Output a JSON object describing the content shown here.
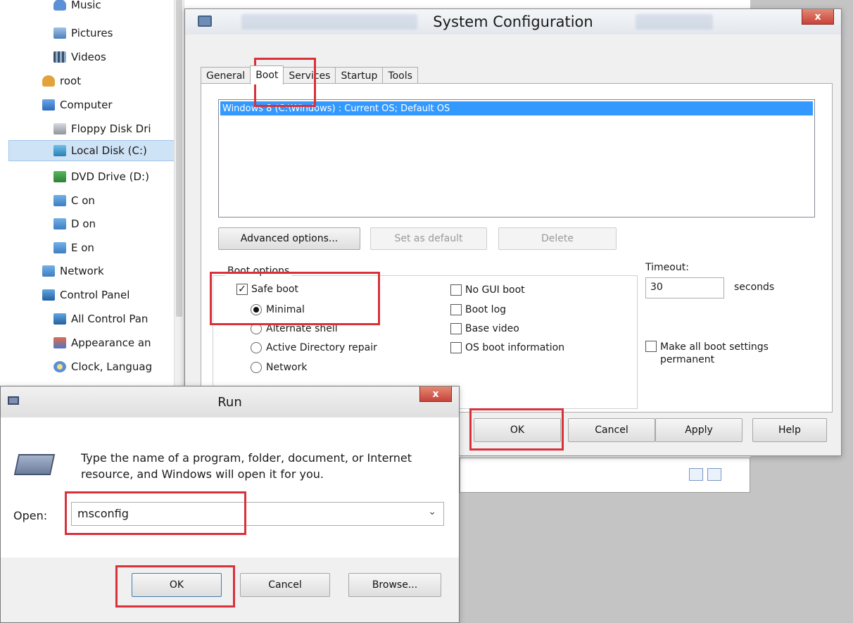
{
  "explorer": {
    "items": [
      {
        "label": "Music",
        "icon": "music-icon"
      },
      {
        "label": "Pictures",
        "icon": "pictures-icon"
      },
      {
        "label": "Videos",
        "icon": "videos-icon"
      },
      {
        "label": "root",
        "icon": "user-folder-icon"
      },
      {
        "label": "Computer",
        "icon": "computer-icon"
      },
      {
        "label": "Floppy Disk Dri",
        "icon": "floppy-drive-icon"
      },
      {
        "label": "Local Disk (C:)",
        "icon": "local-disk-icon"
      },
      {
        "label": "DVD Drive (D:)",
        "icon": "dvd-drive-icon"
      },
      {
        "label": "C on",
        "icon": "network-drive-icon"
      },
      {
        "label": "D on",
        "icon": "network-drive-icon"
      },
      {
        "label": "E on",
        "icon": "network-drive-icon"
      },
      {
        "label": "Network",
        "icon": "network-icon"
      },
      {
        "label": "Control Panel",
        "icon": "control-panel-icon"
      },
      {
        "label": "All Control Pan",
        "icon": "control-panel-icon"
      },
      {
        "label": "Appearance an",
        "icon": "appearance-icon"
      },
      {
        "label": "Clock, Languag",
        "icon": "clock-icon"
      }
    ]
  },
  "syscfg": {
    "title": "System Configuration",
    "close": "x",
    "tabs": [
      "General",
      "Boot",
      "Services",
      "Startup",
      "Tools"
    ],
    "os_entry": "Windows 8 (C:\\Windows) : Current OS; Default OS",
    "buttons": {
      "advanced": "Advanced options...",
      "set_default": "Set as default",
      "delete": "Delete",
      "ok": "OK",
      "cancel": "Cancel",
      "apply": "Apply",
      "help": "Help"
    },
    "boot_options_label": "Boot options",
    "safe_boot": "Safe boot",
    "minimal": "Minimal",
    "alternate_shell": "Alternate shell",
    "ad_repair": "Active Directory repair",
    "network": "Network",
    "no_gui": "No GUI boot",
    "boot_log": "Boot log",
    "base_video": "Base video",
    "os_boot_info": "OS boot information",
    "timeout_label": "Timeout:",
    "timeout_value": "30",
    "seconds": "seconds",
    "make_permanent_1": "Make all boot settings",
    "make_permanent_2": "permanent"
  },
  "run": {
    "title": "Run",
    "close": "x",
    "desc_line1": "Type the name of a program, folder, document, or Internet",
    "desc_line2": "resource, and Windows will open it for you.",
    "open_label": "Open:",
    "open_value": "msconfig",
    "buttons": {
      "ok": "OK",
      "cancel": "Cancel",
      "browse": "Browse..."
    }
  },
  "colors": {
    "highlight": "#d9303a",
    "selection": "#3399ff"
  }
}
